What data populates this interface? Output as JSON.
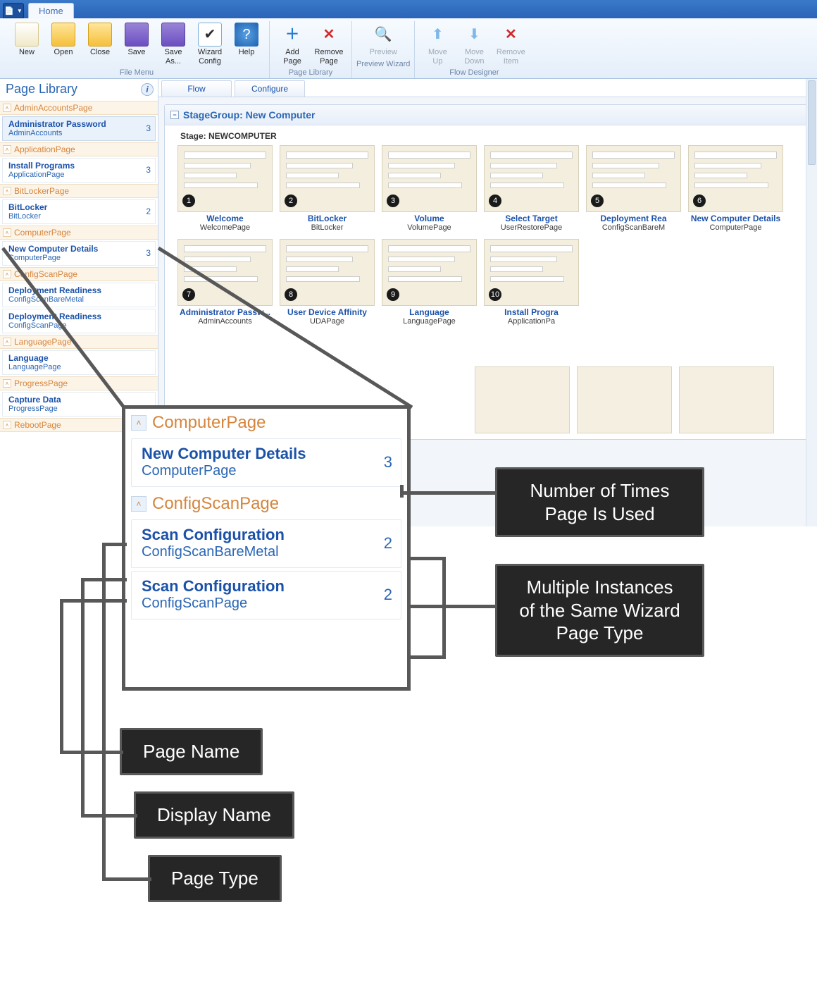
{
  "titlebar": {
    "tab": "Home"
  },
  "ribbon": {
    "groups": [
      {
        "label": "File Menu",
        "buttons": [
          {
            "name": "new-button",
            "label": "New",
            "icon": "new"
          },
          {
            "name": "open-button",
            "label": "Open",
            "icon": "folder"
          },
          {
            "name": "close-button",
            "label": "Close",
            "icon": "folder"
          },
          {
            "name": "save-button",
            "label": "Save",
            "icon": "save"
          },
          {
            "name": "saveas-button",
            "label": "Save As...",
            "icon": "save"
          },
          {
            "name": "wizard-config-button",
            "label": "Wizard Config",
            "icon": "config"
          },
          {
            "name": "help-button",
            "label": "Help",
            "icon": "help"
          }
        ]
      },
      {
        "label": "Page Library",
        "buttons": [
          {
            "name": "add-page-button",
            "label": "Add Page",
            "icon": "add"
          },
          {
            "name": "remove-page-button",
            "label": "Remove Page",
            "icon": "remove"
          }
        ]
      },
      {
        "label": "Preview Wizard",
        "buttons": [
          {
            "name": "preview-button",
            "label": "Preview",
            "icon": "preview",
            "disabled": true
          }
        ]
      },
      {
        "label": "Flow Designer",
        "buttons": [
          {
            "name": "move-up-button",
            "label": "Move Up",
            "icon": "up",
            "disabled": true
          },
          {
            "name": "move-down-button",
            "label": "Move Down",
            "icon": "down",
            "disabled": true
          },
          {
            "name": "remove-item-button",
            "label": "Remove Item",
            "icon": "remove",
            "disabled": true
          }
        ]
      }
    ]
  },
  "sidebar": {
    "title": "Page Library",
    "groups": [
      {
        "name": "AdminAccountsPage",
        "items": [
          {
            "display": "Administrator Password",
            "page": "AdminAccounts",
            "count": 3,
            "selected": true
          }
        ]
      },
      {
        "name": "ApplicationPage",
        "items": [
          {
            "display": "Install Programs",
            "page": "ApplicationPage",
            "count": 3
          }
        ]
      },
      {
        "name": "BitLockerPage",
        "items": [
          {
            "display": "BitLocker",
            "page": "BitLocker",
            "count": 2
          }
        ]
      },
      {
        "name": "ComputerPage",
        "items": [
          {
            "display": "New Computer Details",
            "page": "ComputerPage",
            "count": 3
          }
        ]
      },
      {
        "name": "ConfigScanPage",
        "items": [
          {
            "display": "Deployment Readiness",
            "page": "ConfigScanBareMetal",
            "count": ""
          },
          {
            "display": "Deployment Readiness",
            "page": "ConfigScanPage",
            "count": ""
          }
        ]
      },
      {
        "name": "LanguagePage",
        "items": [
          {
            "display": "Language",
            "page": "LanguagePage",
            "count": ""
          }
        ]
      },
      {
        "name": "ProgressPage",
        "items": [
          {
            "display": "Capture Data",
            "page": "ProgressPage",
            "count": ""
          }
        ]
      },
      {
        "name": "RebootPage",
        "items": []
      }
    ]
  },
  "subtabs": [
    "Flow",
    "Configure"
  ],
  "stagegroup": {
    "title": "StageGroup: New Computer",
    "stage": "Stage: NEWCOMPUTER",
    "pages": [
      {
        "n": 1,
        "title": "Welcome",
        "sub": "WelcomePage"
      },
      {
        "n": 2,
        "title": "BitLocker",
        "sub": "BitLocker"
      },
      {
        "n": 3,
        "title": "Volume",
        "sub": "VolumePage"
      },
      {
        "n": 4,
        "title": "Select Target",
        "sub": "UserRestorePage"
      },
      {
        "n": 5,
        "title": "Deployment Rea",
        "sub": "ConfigScanBareM"
      },
      {
        "n": 6,
        "title": "New Computer Details",
        "sub": "ComputerPage"
      },
      {
        "n": 7,
        "title": "Administrator Passw...",
        "sub": "AdminAccounts"
      },
      {
        "n": 8,
        "title": "User Device Affinity",
        "sub": "UDAPage"
      },
      {
        "n": 9,
        "title": "Language",
        "sub": "LanguagePage"
      },
      {
        "n": 10,
        "title": "Install Progra",
        "sub": "ApplicationPa"
      }
    ]
  },
  "zoom": {
    "groups": [
      {
        "name": "ComputerPage",
        "items": [
          {
            "display": "New Computer Details",
            "page": "ComputerPage",
            "count": 3
          }
        ]
      },
      {
        "name": "ConfigScanPage",
        "items": [
          {
            "display": "Scan Configuration",
            "page": "ConfigScanBareMetal",
            "count": 2
          },
          {
            "display": "Scan Configuration",
            "page": "ConfigScanPage",
            "count": 2
          }
        ]
      }
    ]
  },
  "callouts": {
    "count": "Number of Times Page Is Used",
    "multi": "Multiple Instances of the Same Wizard Page Type",
    "pagename": "Page Name",
    "displayname": "Display Name",
    "pagetype": "Page Type"
  }
}
